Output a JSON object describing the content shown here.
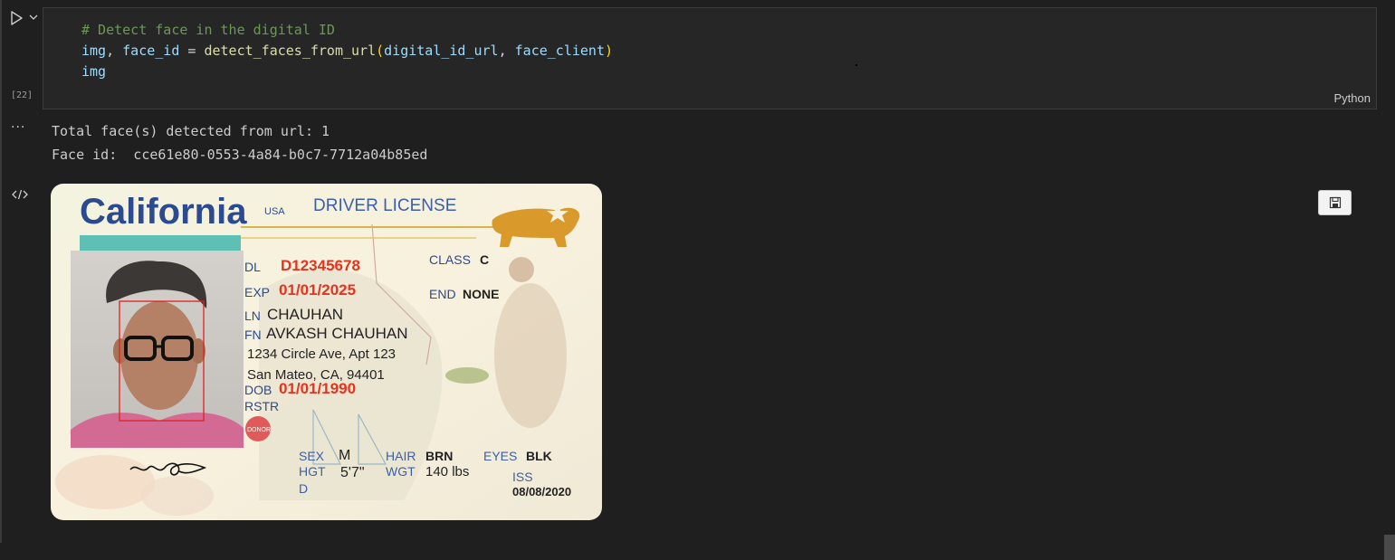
{
  "cell": {
    "execution_count": "[22]",
    "language": "Python",
    "code": {
      "line1": "# Detect face in the digital ID",
      "line2_var1": "img",
      "line2_comma": ", ",
      "line2_var2": "face_id",
      "line2_eq": " = ",
      "line2_fn": "detect_faces_from_url",
      "line2_paren_open": "(",
      "line2_arg1": "digital_id_url",
      "line2_sep": ", ",
      "line2_arg2": "face_client",
      "line2_paren_close": ")",
      "line3": "img"
    }
  },
  "output": {
    "more_label": "···",
    "line1": "Total face(s) detected from url: 1",
    "line2": "Face id:  cce61e80-0553-4a84-b0c7-7712a04b85ed"
  },
  "license": {
    "state": "California",
    "usa": "USA",
    "title": "DRIVER LICENSE",
    "dl_label": "DL",
    "dl_number": "D12345678",
    "class_label": "CLASS",
    "class_value": "C",
    "exp_label": "EXP",
    "exp_value": "01/01/2025",
    "end_label": "END",
    "end_value": "NONE",
    "ln_label": "LN",
    "ln_value": "CHAUHAN",
    "fn_label": "FN",
    "fn_value": "AVKASH CHAUHAN",
    "address1": "1234 Circle Ave, Apt 123",
    "address2": "San Mateo, CA, 94401",
    "dob_label": "DOB",
    "dob_value": "01/01/1990",
    "rstr_label": "RSTR",
    "donor": "DONOR",
    "sex_label": "SEX",
    "sex_value": "M",
    "hgt_label": "HGT",
    "hgt_value": "5'7\"",
    "hair_label": "HAIR",
    "hair_value": "BRN",
    "wgt_label": "WGT",
    "wgt_value": "140 lbs",
    "eyes_label": "EYES",
    "eyes_value": "BLK",
    "iss_label": "ISS",
    "iss_value": "08/08/2020",
    "d_label": "D"
  },
  "colors": {
    "background": "#1f1f1f",
    "cell_bg": "#262626",
    "face_box": "#e02020",
    "license_blue": "#2b4a8f",
    "license_red": "#e8321e"
  }
}
